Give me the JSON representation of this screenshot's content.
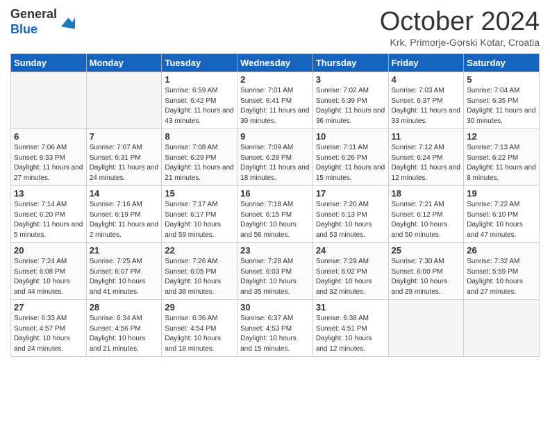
{
  "header": {
    "logo_general": "General",
    "logo_blue": "Blue",
    "month_title": "October 2024",
    "location": "Krk, Primorje-Gorski Kotar, Croatia"
  },
  "days_of_week": [
    "Sunday",
    "Monday",
    "Tuesday",
    "Wednesday",
    "Thursday",
    "Friday",
    "Saturday"
  ],
  "weeks": [
    [
      {
        "num": "",
        "detail": ""
      },
      {
        "num": "",
        "detail": ""
      },
      {
        "num": "1",
        "detail": "Sunrise: 6:59 AM\nSunset: 6:42 PM\nDaylight: 11 hours and 43 minutes."
      },
      {
        "num": "2",
        "detail": "Sunrise: 7:01 AM\nSunset: 6:41 PM\nDaylight: 11 hours and 39 minutes."
      },
      {
        "num": "3",
        "detail": "Sunrise: 7:02 AM\nSunset: 6:39 PM\nDaylight: 11 hours and 36 minutes."
      },
      {
        "num": "4",
        "detail": "Sunrise: 7:03 AM\nSunset: 6:37 PM\nDaylight: 11 hours and 33 minutes."
      },
      {
        "num": "5",
        "detail": "Sunrise: 7:04 AM\nSunset: 6:35 PM\nDaylight: 11 hours and 30 minutes."
      }
    ],
    [
      {
        "num": "6",
        "detail": "Sunrise: 7:06 AM\nSunset: 6:33 PM\nDaylight: 11 hours and 27 minutes."
      },
      {
        "num": "7",
        "detail": "Sunrise: 7:07 AM\nSunset: 6:31 PM\nDaylight: 11 hours and 24 minutes."
      },
      {
        "num": "8",
        "detail": "Sunrise: 7:08 AM\nSunset: 6:29 PM\nDaylight: 11 hours and 21 minutes."
      },
      {
        "num": "9",
        "detail": "Sunrise: 7:09 AM\nSunset: 6:28 PM\nDaylight: 11 hours and 18 minutes."
      },
      {
        "num": "10",
        "detail": "Sunrise: 7:11 AM\nSunset: 6:26 PM\nDaylight: 11 hours and 15 minutes."
      },
      {
        "num": "11",
        "detail": "Sunrise: 7:12 AM\nSunset: 6:24 PM\nDaylight: 11 hours and 12 minutes."
      },
      {
        "num": "12",
        "detail": "Sunrise: 7:13 AM\nSunset: 6:22 PM\nDaylight: 11 hours and 8 minutes."
      }
    ],
    [
      {
        "num": "13",
        "detail": "Sunrise: 7:14 AM\nSunset: 6:20 PM\nDaylight: 11 hours and 5 minutes."
      },
      {
        "num": "14",
        "detail": "Sunrise: 7:16 AM\nSunset: 6:19 PM\nDaylight: 11 hours and 2 minutes."
      },
      {
        "num": "15",
        "detail": "Sunrise: 7:17 AM\nSunset: 6:17 PM\nDaylight: 10 hours and 59 minutes."
      },
      {
        "num": "16",
        "detail": "Sunrise: 7:18 AM\nSunset: 6:15 PM\nDaylight: 10 hours and 56 minutes."
      },
      {
        "num": "17",
        "detail": "Sunrise: 7:20 AM\nSunset: 6:13 PM\nDaylight: 10 hours and 53 minutes."
      },
      {
        "num": "18",
        "detail": "Sunrise: 7:21 AM\nSunset: 6:12 PM\nDaylight: 10 hours and 50 minutes."
      },
      {
        "num": "19",
        "detail": "Sunrise: 7:22 AM\nSunset: 6:10 PM\nDaylight: 10 hours and 47 minutes."
      }
    ],
    [
      {
        "num": "20",
        "detail": "Sunrise: 7:24 AM\nSunset: 6:08 PM\nDaylight: 10 hours and 44 minutes."
      },
      {
        "num": "21",
        "detail": "Sunrise: 7:25 AM\nSunset: 6:07 PM\nDaylight: 10 hours and 41 minutes."
      },
      {
        "num": "22",
        "detail": "Sunrise: 7:26 AM\nSunset: 6:05 PM\nDaylight: 10 hours and 38 minutes."
      },
      {
        "num": "23",
        "detail": "Sunrise: 7:28 AM\nSunset: 6:03 PM\nDaylight: 10 hours and 35 minutes."
      },
      {
        "num": "24",
        "detail": "Sunrise: 7:29 AM\nSunset: 6:02 PM\nDaylight: 10 hours and 32 minutes."
      },
      {
        "num": "25",
        "detail": "Sunrise: 7:30 AM\nSunset: 6:00 PM\nDaylight: 10 hours and 29 minutes."
      },
      {
        "num": "26",
        "detail": "Sunrise: 7:32 AM\nSunset: 5:59 PM\nDaylight: 10 hours and 27 minutes."
      }
    ],
    [
      {
        "num": "27",
        "detail": "Sunrise: 6:33 AM\nSunset: 4:57 PM\nDaylight: 10 hours and 24 minutes."
      },
      {
        "num": "28",
        "detail": "Sunrise: 6:34 AM\nSunset: 4:56 PM\nDaylight: 10 hours and 21 minutes."
      },
      {
        "num": "29",
        "detail": "Sunrise: 6:36 AM\nSunset: 4:54 PM\nDaylight: 10 hours and 18 minutes."
      },
      {
        "num": "30",
        "detail": "Sunrise: 6:37 AM\nSunset: 4:53 PM\nDaylight: 10 hours and 15 minutes."
      },
      {
        "num": "31",
        "detail": "Sunrise: 6:38 AM\nSunset: 4:51 PM\nDaylight: 10 hours and 12 minutes."
      },
      {
        "num": "",
        "detail": ""
      },
      {
        "num": "",
        "detail": ""
      }
    ]
  ]
}
